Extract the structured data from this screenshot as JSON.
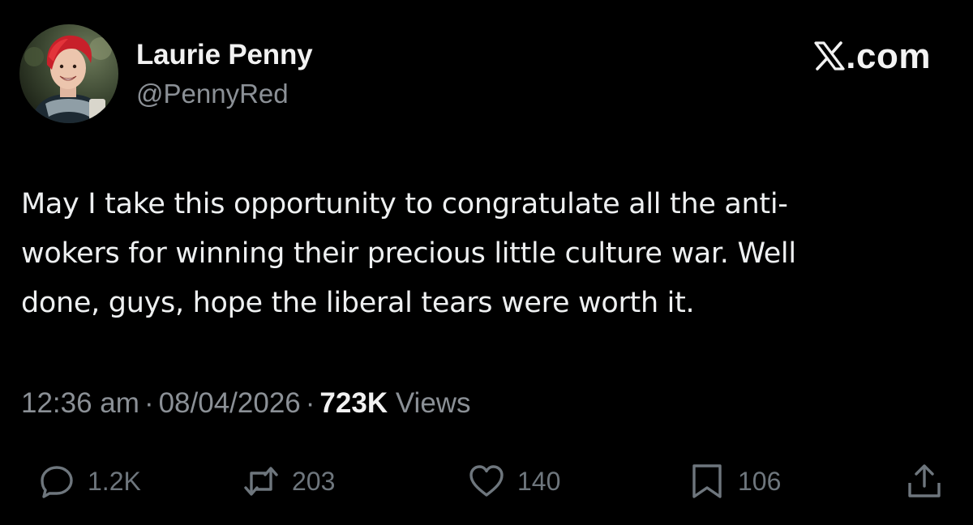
{
  "author": {
    "display_name": "Laurie Penny",
    "handle": "@PennyRed",
    "avatar_icon": "profile-photo"
  },
  "brand": {
    "label": ".com",
    "icon": "x-logo-icon"
  },
  "tweet": {
    "lines": [
      "May I take this opportunity to congratulate all the anti-",
      "wokers for winning their precious little culture war. Well",
      "done, guys, hope the liberal tears were worth it."
    ]
  },
  "meta": {
    "time": "12:36 am",
    "separator": "·",
    "date": "08/04/2026",
    "views_count": "723K",
    "views_label": "Views"
  },
  "actions": {
    "reply": {
      "icon": "reply-icon",
      "count": "1.2K"
    },
    "repost": {
      "icon": "repost-icon",
      "count": "203"
    },
    "like": {
      "icon": "heart-icon",
      "count": "140"
    },
    "bookmark": {
      "icon": "bookmark-icon",
      "count": "106"
    },
    "share": {
      "icon": "share-icon"
    }
  },
  "colors": {
    "background": "#000000",
    "primary_text": "#e7e9ea",
    "secondary_text": "#8b9096",
    "icon": "#6e767d"
  }
}
